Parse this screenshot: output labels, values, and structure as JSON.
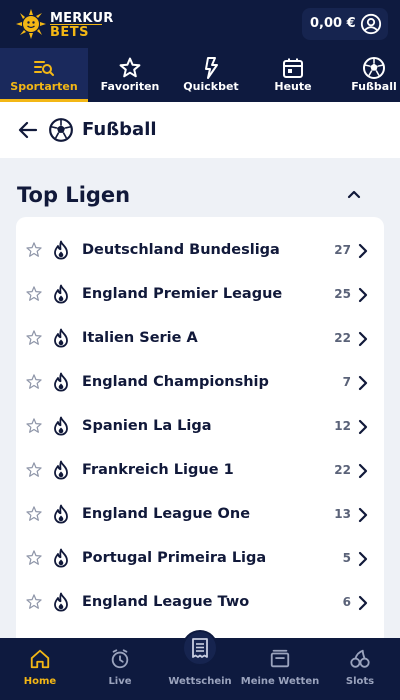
{
  "brand": {
    "line1": "MERKUR",
    "line2": "BETS"
  },
  "header": {
    "balance": "0,00 €"
  },
  "sport_nav": [
    {
      "label": "Sportarten",
      "icon": "sports-list-icon",
      "active": true
    },
    {
      "label": "Favoriten",
      "icon": "star-icon",
      "active": false
    },
    {
      "label": "Quickbet",
      "icon": "lightning-icon",
      "active": false
    },
    {
      "label": "Heute",
      "icon": "calendar-icon",
      "active": false
    },
    {
      "label": "Fußball",
      "icon": "football-icon",
      "active": false
    }
  ],
  "page": {
    "title": "Fußball"
  },
  "section": {
    "title": "Top Ligen"
  },
  "leagues": [
    {
      "name": "Deutschland Bundesliga",
      "count": "27"
    },
    {
      "name": "England Premier League",
      "count": "25"
    },
    {
      "name": "Italien Serie A",
      "count": "22"
    },
    {
      "name": "England Championship",
      "count": "7"
    },
    {
      "name": "Spanien La Liga",
      "count": "12"
    },
    {
      "name": "Frankreich Ligue 1",
      "count": "22"
    },
    {
      "name": "England League One",
      "count": "13"
    },
    {
      "name": "Portugal Primeira Liga",
      "count": "5"
    },
    {
      "name": "England League Two",
      "count": "6"
    }
  ],
  "bottom_nav": [
    {
      "label": "Home",
      "icon": "home-icon",
      "active": true
    },
    {
      "label": "Live",
      "icon": "stopwatch-icon",
      "active": false
    },
    {
      "label": "Wettschein",
      "icon": "betslip-icon",
      "active": false
    },
    {
      "label": "Meine Wetten",
      "icon": "my-bets-icon",
      "active": false
    },
    {
      "label": "Slots",
      "icon": "slots-icon",
      "active": false
    }
  ],
  "colors": {
    "navy": "#0e1a3f",
    "accent": "#f3b715",
    "page_bg": "#eef1f6"
  }
}
